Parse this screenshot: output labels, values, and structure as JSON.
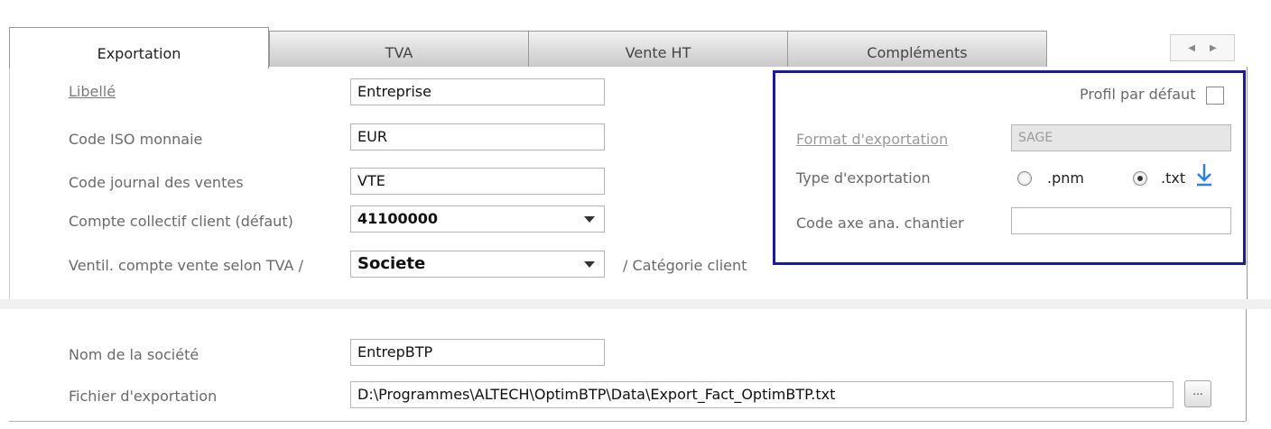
{
  "tabs": [
    {
      "label": "Exportation",
      "active": true
    },
    {
      "label": "TVA",
      "active": false
    },
    {
      "label": "Vente HT",
      "active": false
    },
    {
      "label": "Compléments",
      "active": false
    }
  ],
  "form": {
    "libelle": {
      "label": "Libellé",
      "value": "Entreprise"
    },
    "code_iso": {
      "label": "Code ISO monnaie",
      "value": "EUR"
    },
    "code_journal": {
      "label": "Code journal des ventes",
      "value": "VTE"
    },
    "compte_collectif": {
      "label": "Compte collectif client (défaut)",
      "value": "41100000"
    },
    "ventil": {
      "label": "Ventil. compte vente selon TVA /",
      "value": "Societe",
      "suffix": "/ Catégorie client"
    }
  },
  "right": {
    "profil_defaut": {
      "label": "Profil par défaut",
      "checked": false
    },
    "format_export": {
      "label": "Format d'exportation",
      "value": "SAGE"
    },
    "type_export": {
      "label": "Type d'exportation",
      "options": [
        ".pnm",
        ".txt"
      ],
      "selected": ".txt"
    },
    "code_axe": {
      "label": "Code axe ana. chantier",
      "value": ""
    }
  },
  "bottom": {
    "nom_societe": {
      "label": "Nom de la société",
      "value": "EntrepBTP"
    },
    "fichier": {
      "label": "Fichier d'exportation",
      "value": "D:\\Programmes\\ALTECH\\OptimBTP\\Data\\Export_Fact_OptimBTP.txt"
    },
    "browse_label": "..."
  },
  "colors": {
    "highlight": "#1a1a9e",
    "download_arrow": "#2f7fe0"
  },
  "icons": {
    "download": "download-arrow-icon",
    "tab_prev": "chevron-left-icon",
    "tab_next": "chevron-right-icon"
  }
}
